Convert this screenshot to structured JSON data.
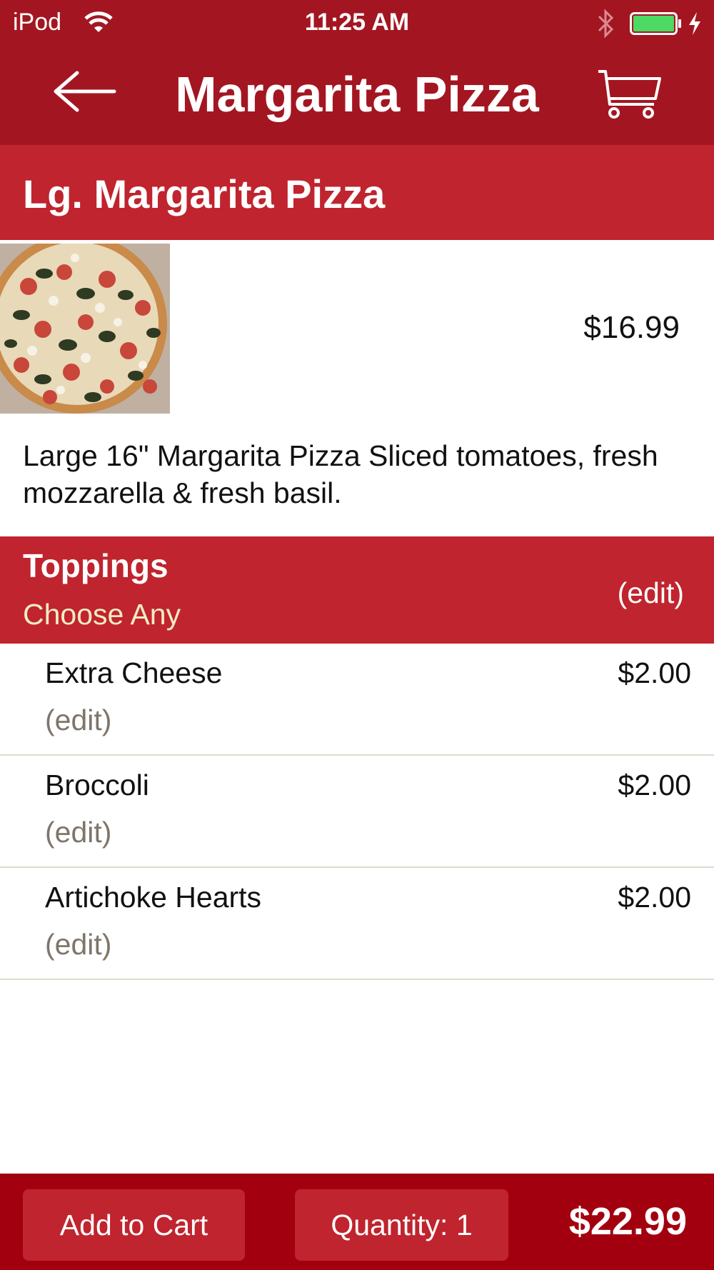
{
  "status_bar": {
    "carrier": "iPod",
    "time": "11:25 AM"
  },
  "nav": {
    "title": "Margarita Pizza",
    "back_icon": "back-arrow-icon",
    "cart_icon": "shopping-cart-icon"
  },
  "item": {
    "name": "Lg. Margarita Pizza",
    "price": "$16.99",
    "description": "Large 16\"  Margarita Pizza Sliced tomatoes, fresh mozzarella & fresh basil."
  },
  "toppings": {
    "title": "Toppings",
    "subtitle": "Choose Any",
    "edit_label": "(edit)",
    "items": [
      {
        "name": "Extra Cheese",
        "price": "$2.00",
        "edit_label": "(edit)"
      },
      {
        "name": "Broccoli",
        "price": "$2.00",
        "edit_label": "(edit)"
      },
      {
        "name": "Artichoke Hearts",
        "price": "$2.00",
        "edit_label": "(edit)"
      }
    ]
  },
  "footer": {
    "add_to_cart_label": "Add to Cart",
    "quantity_label": "Quantity: 1",
    "total": "$22.99"
  },
  "colors": {
    "nav_red": "#a31621",
    "section_red": "#c0242e",
    "footer_red": "#a3000f",
    "subtitle_cream": "#f1ecc2",
    "edit_gray": "#7e7669",
    "battery_green": "#4cd964"
  }
}
